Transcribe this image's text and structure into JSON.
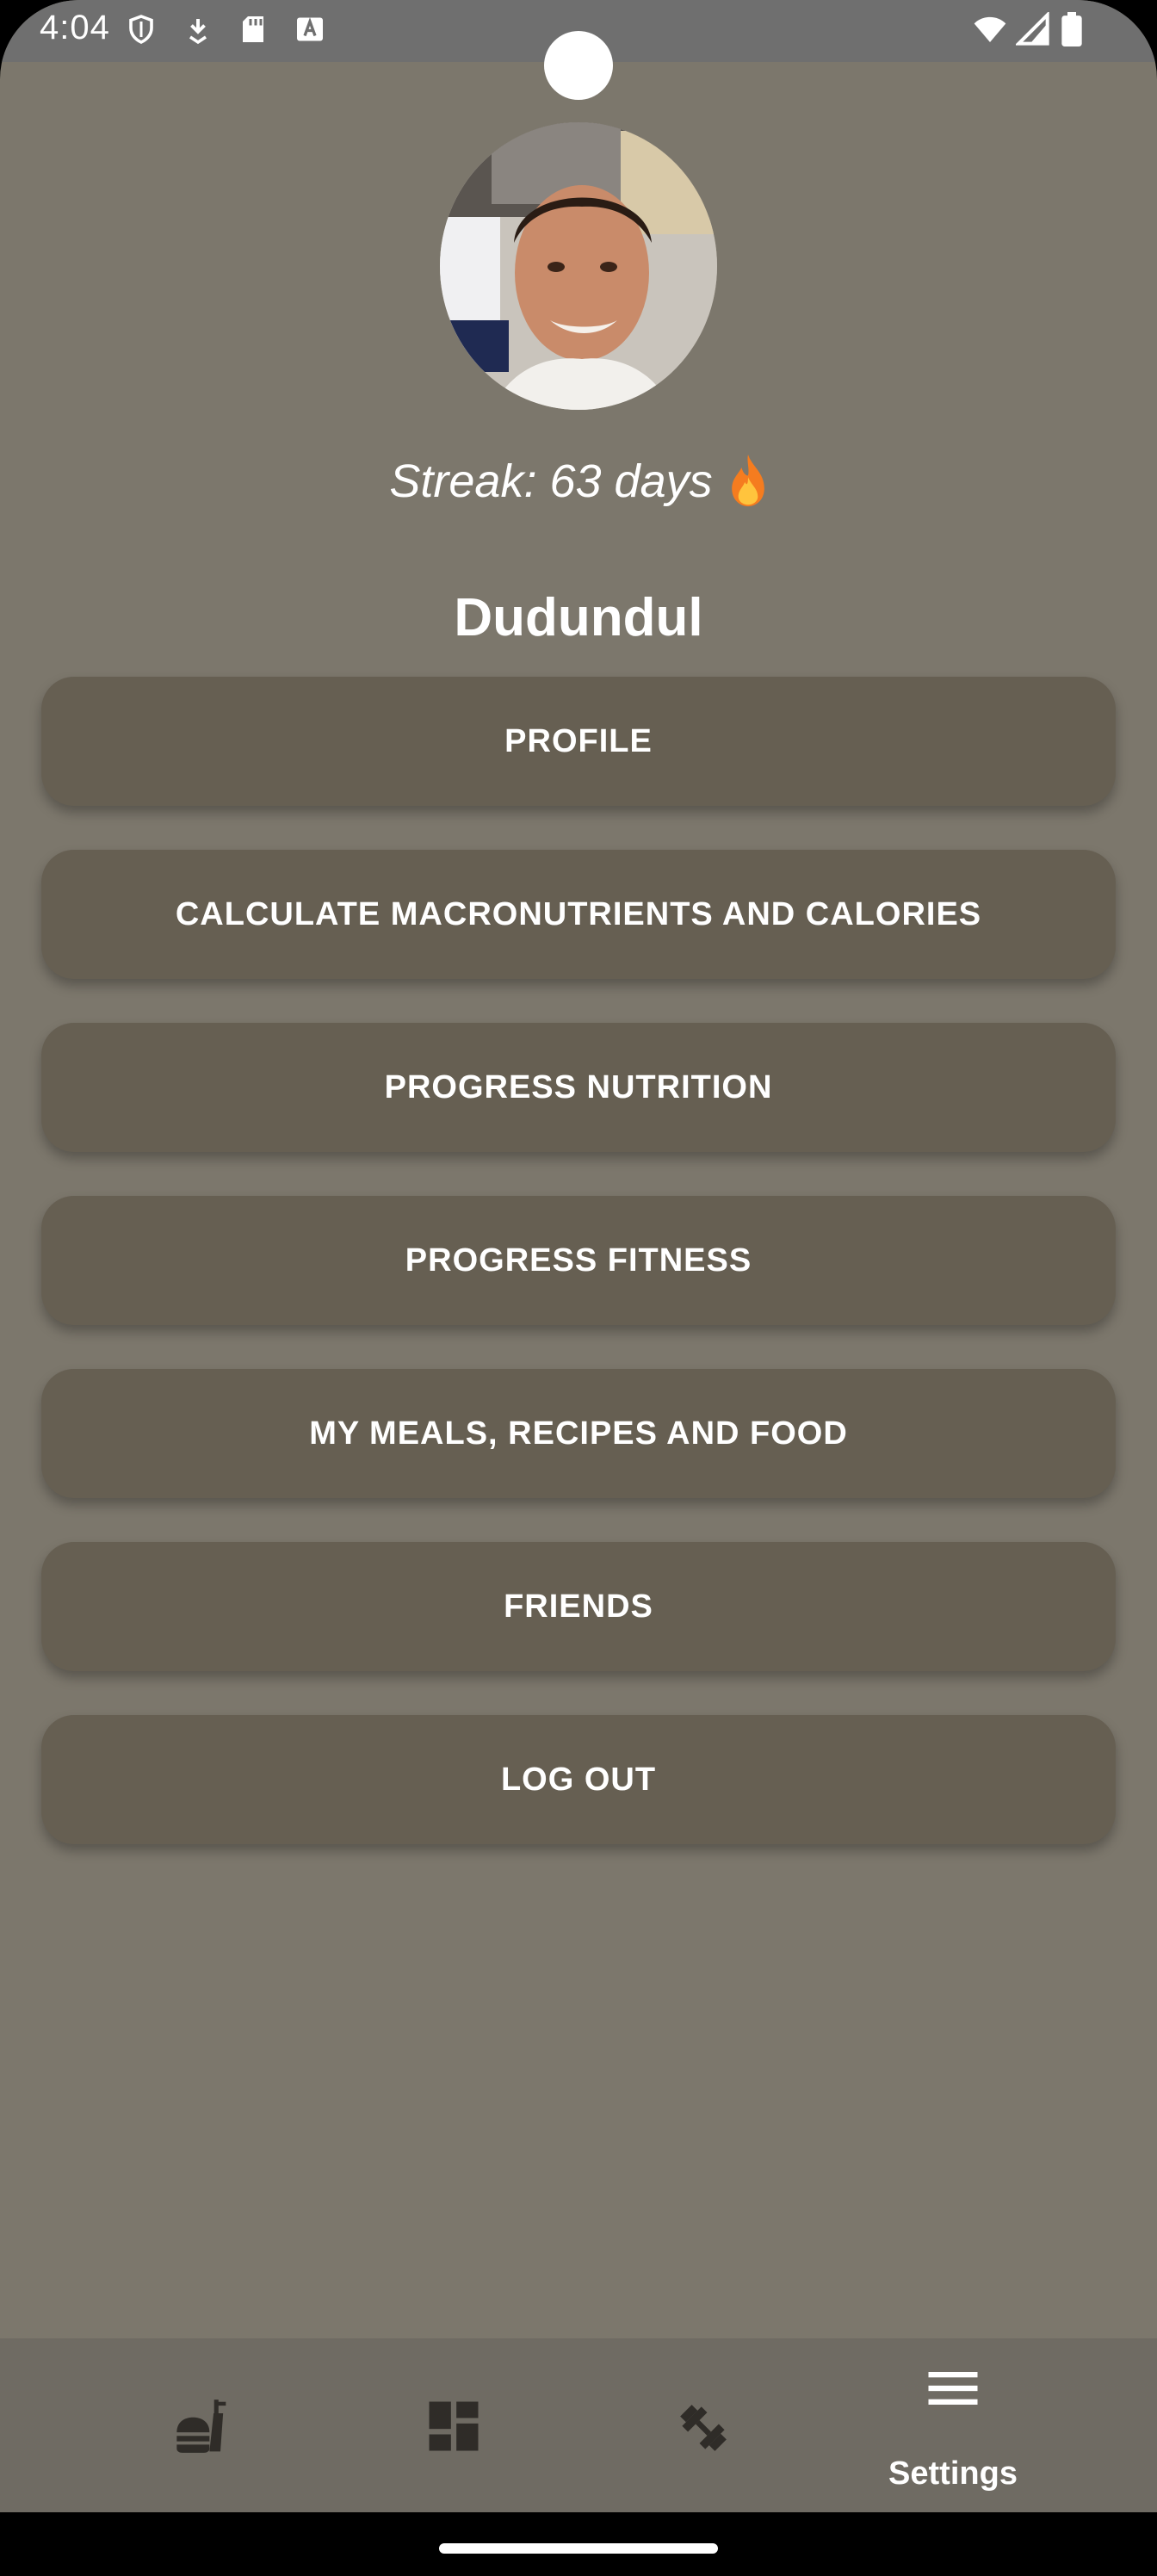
{
  "status_bar": {
    "time": "4:04",
    "icons": [
      "shield-icon",
      "download-icon",
      "sd-card-icon",
      "a-text-icon",
      "wifi-icon",
      "signal-icon",
      "battery-icon"
    ]
  },
  "profile": {
    "streak_text": "Streak: 63 days",
    "streak_icon": "flame-icon",
    "username": "Dudundul"
  },
  "menu": {
    "items": [
      {
        "label": "PROFILE"
      },
      {
        "label": "CALCULATE MACRONUTRIENTS AND CALORIES"
      },
      {
        "label": "PROGRESS NUTRITION"
      },
      {
        "label": "PROGRESS FITNESS"
      },
      {
        "label": "MY MEALS, RECIPES AND FOOD"
      },
      {
        "label": "FRIENDS"
      },
      {
        "label": "LOG OUT"
      }
    ]
  },
  "bottom_nav": {
    "items": [
      {
        "icon": "fastfood-icon",
        "label": ""
      },
      {
        "icon": "dashboard-icon",
        "label": ""
      },
      {
        "icon": "fitness-icon",
        "label": ""
      },
      {
        "icon": "menu-icon",
        "label": "Settings",
        "selected": true
      }
    ]
  },
  "colors": {
    "background": "#7c776c",
    "button": "#665f52",
    "nav_bar": "#6f6b63",
    "status_bar": "#6f6f6f",
    "text": "#ffffff"
  }
}
